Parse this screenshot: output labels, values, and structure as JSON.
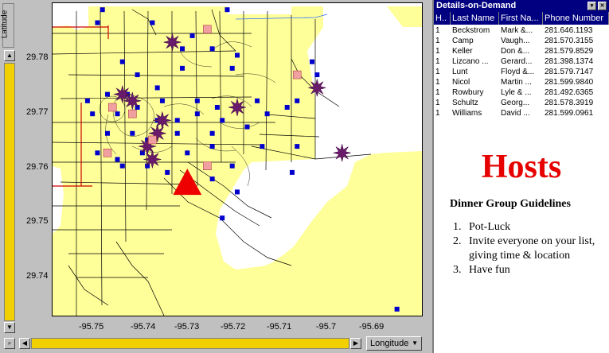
{
  "y_axis": {
    "label": "Latitude",
    "ticks": [
      "29.78",
      "29.77",
      "29.76",
      "29.75",
      "29.74"
    ]
  },
  "x_axis": {
    "label": "Longitude",
    "ticks": [
      "-95.75",
      "-95.74",
      "-95.73",
      "-95.72",
      "-95.71",
      "-95.7",
      "-95.69"
    ]
  },
  "chart_data": {
    "type": "scatter",
    "xlabel": "Longitude",
    "ylabel": "Latitude",
    "xlim": [
      -95.758,
      -95.684
    ],
    "ylim": [
      29.737,
      29.785
    ],
    "series": [
      {
        "marker": "blue-square",
        "color": "#0000cc",
        "points": [
          [
            -95.749,
            29.782
          ],
          [
            -95.738,
            29.782
          ],
          [
            -95.73,
            29.78
          ],
          [
            -95.732,
            29.778
          ],
          [
            -95.726,
            29.778
          ],
          [
            -95.744,
            29.776
          ],
          [
            -95.741,
            29.774
          ],
          [
            -95.732,
            29.775
          ],
          [
            -95.721,
            29.777
          ],
          [
            -95.722,
            29.775
          ],
          [
            -95.706,
            29.776
          ],
          [
            -95.705,
            29.774
          ],
          [
            -95.737,
            29.772
          ],
          [
            -95.743,
            29.771
          ],
          [
            -95.747,
            29.771
          ],
          [
            -95.751,
            29.77
          ],
          [
            -95.75,
            29.768
          ],
          [
            -95.745,
            29.768
          ],
          [
            -95.741,
            29.769
          ],
          [
            -95.736,
            29.77
          ],
          [
            -95.729,
            29.77
          ],
          [
            -95.725,
            29.769
          ],
          [
            -95.717,
            29.77
          ],
          [
            -95.715,
            29.768
          ],
          [
            -95.711,
            29.769
          ],
          [
            -95.709,
            29.77
          ],
          [
            -95.737,
            29.767
          ],
          [
            -95.733,
            29.767
          ],
          [
            -95.729,
            29.768
          ],
          [
            -95.724,
            29.767
          ],
          [
            -95.747,
            29.765
          ],
          [
            -95.742,
            29.765
          ],
          [
            -95.739,
            29.764
          ],
          [
            -95.733,
            29.765
          ],
          [
            -95.726,
            29.765
          ],
          [
            -95.719,
            29.766
          ],
          [
            -95.749,
            29.762
          ],
          [
            -95.745,
            29.761
          ],
          [
            -95.74,
            29.762
          ],
          [
            -95.731,
            29.762
          ],
          [
            -95.726,
            29.763
          ],
          [
            -95.744,
            29.76
          ],
          [
            -95.739,
            29.76
          ],
          [
            -95.735,
            29.759
          ],
          [
            -95.727,
            29.76
          ],
          [
            -95.722,
            29.76
          ],
          [
            -95.709,
            29.763
          ],
          [
            -95.7,
            29.762
          ],
          [
            -95.726,
            29.758
          ],
          [
            -95.721,
            29.756
          ],
          [
            -95.724,
            29.752
          ],
          [
            -95.71,
            29.759
          ],
          [
            -95.748,
            29.784
          ],
          [
            -95.723,
            29.784
          ],
          [
            -95.689,
            29.738
          ],
          [
            -95.716,
            29.763
          ]
        ]
      },
      {
        "marker": "star",
        "color": "#6a1a6a",
        "points": [
          [
            -95.734,
            29.779
          ],
          [
            -95.744,
            29.771
          ],
          [
            -95.721,
            29.769
          ],
          [
            -95.705,
            29.772
          ],
          [
            -95.7,
            29.762
          ],
          [
            -95.736,
            29.767
          ],
          [
            -95.737,
            29.765
          ],
          [
            -95.739,
            29.763
          ],
          [
            -95.738,
            29.761
          ],
          [
            -95.742,
            29.77
          ]
        ]
      },
      {
        "marker": "pink-square",
        "color": "#f0a0a0",
        "points": [
          [
            -95.727,
            29.781
          ],
          [
            -95.709,
            29.774
          ],
          [
            -95.746,
            29.769
          ],
          [
            -95.742,
            29.768
          ],
          [
            -95.738,
            29.764
          ],
          [
            -95.727,
            29.76
          ],
          [
            -95.747,
            29.762
          ]
        ]
      },
      {
        "marker": "red-triangle",
        "color": "#ee0000",
        "points": [
          [
            -95.731,
            29.7575
          ]
        ]
      }
    ]
  },
  "details": {
    "title": "Details-on-Demand",
    "columns": [
      "H..",
      "Last Name",
      "First Na...",
      "Phone Number"
    ],
    "rows": [
      [
        "1",
        "Beckstrom",
        "Mark &...",
        "281.646.1193"
      ],
      [
        "1",
        "Camp",
        "Vaugh...",
        "281.570.3155"
      ],
      [
        "1",
        "Keller",
        "Don &...",
        "281.579.8529"
      ],
      [
        "1",
        "Lizcano ...",
        "Gerard...",
        "281.398.1374"
      ],
      [
        "1",
        "Lunt",
        "Floyd &...",
        "281.579.7147"
      ],
      [
        "1",
        "Nicol",
        "Martin ...",
        "281.599.9840"
      ],
      [
        "1",
        "Rowbury",
        "Lyle & ...",
        "281.492.6365"
      ],
      [
        "1",
        "Schultz",
        "Georg...",
        "281.578.3919"
      ],
      [
        "1",
        "Williams",
        "David ...",
        "281.599.0961"
      ]
    ]
  },
  "hosts_heading": "Hosts",
  "guidelines": {
    "title": "Dinner Group Guidelines",
    "items": [
      {
        "n": "1.",
        "text": "Pot-Luck"
      },
      {
        "n": "2.",
        "text": "Invite everyone on your list, giving time & location"
      },
      {
        "n": "3.",
        "text": "Have fun"
      }
    ]
  },
  "colors": {
    "slider": "#f0d000",
    "map_land": "#ffff99",
    "title_bar": "#000080",
    "hosts": "#e60000"
  }
}
